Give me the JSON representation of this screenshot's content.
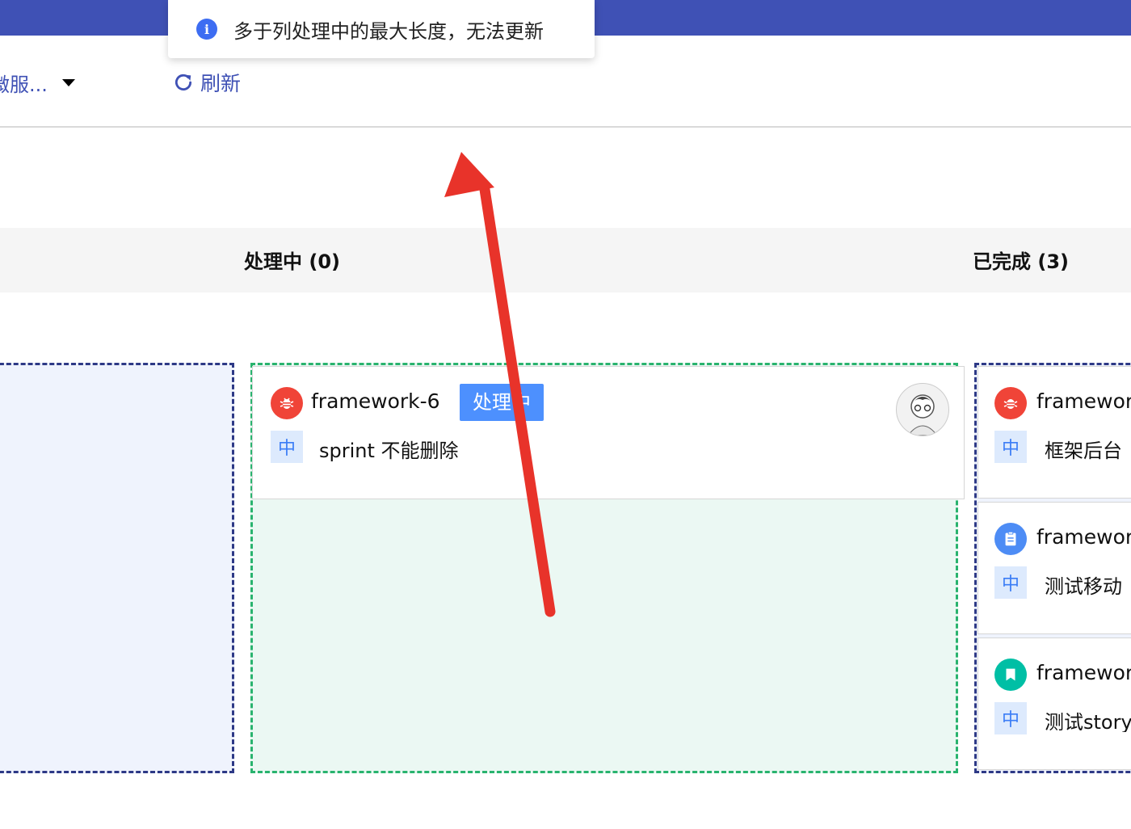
{
  "toast": {
    "message": "多于列处理中的最大长度，无法更新"
  },
  "toolbar": {
    "service_label": "微服...",
    "refresh_label": "刷新"
  },
  "columns": [
    {
      "title": "处理中 (0)"
    },
    {
      "title": "已完成 (3)"
    }
  ],
  "main_card": {
    "key": "framework-6",
    "status": "处理中",
    "priority": "中",
    "summary": "sprint 不能删除",
    "type_icon": "bug-icon"
  },
  "right_cards": [
    {
      "key": "framework",
      "priority": "中",
      "summary": "框架后台",
      "type_icon": "bug-icon"
    },
    {
      "key": "framework",
      "priority": "中",
      "summary": "测试移动",
      "type_icon": "task-icon"
    },
    {
      "key": "framework",
      "priority": "中",
      "summary": "测试story",
      "type_icon": "story-icon"
    }
  ],
  "colors": {
    "topbar": "#3f51b5",
    "bug": "#f04438",
    "task": "#4d8cf5",
    "story": "#00bfa5",
    "status_tag": "#4d90fe",
    "annotation_arrow": "#e8332a"
  }
}
